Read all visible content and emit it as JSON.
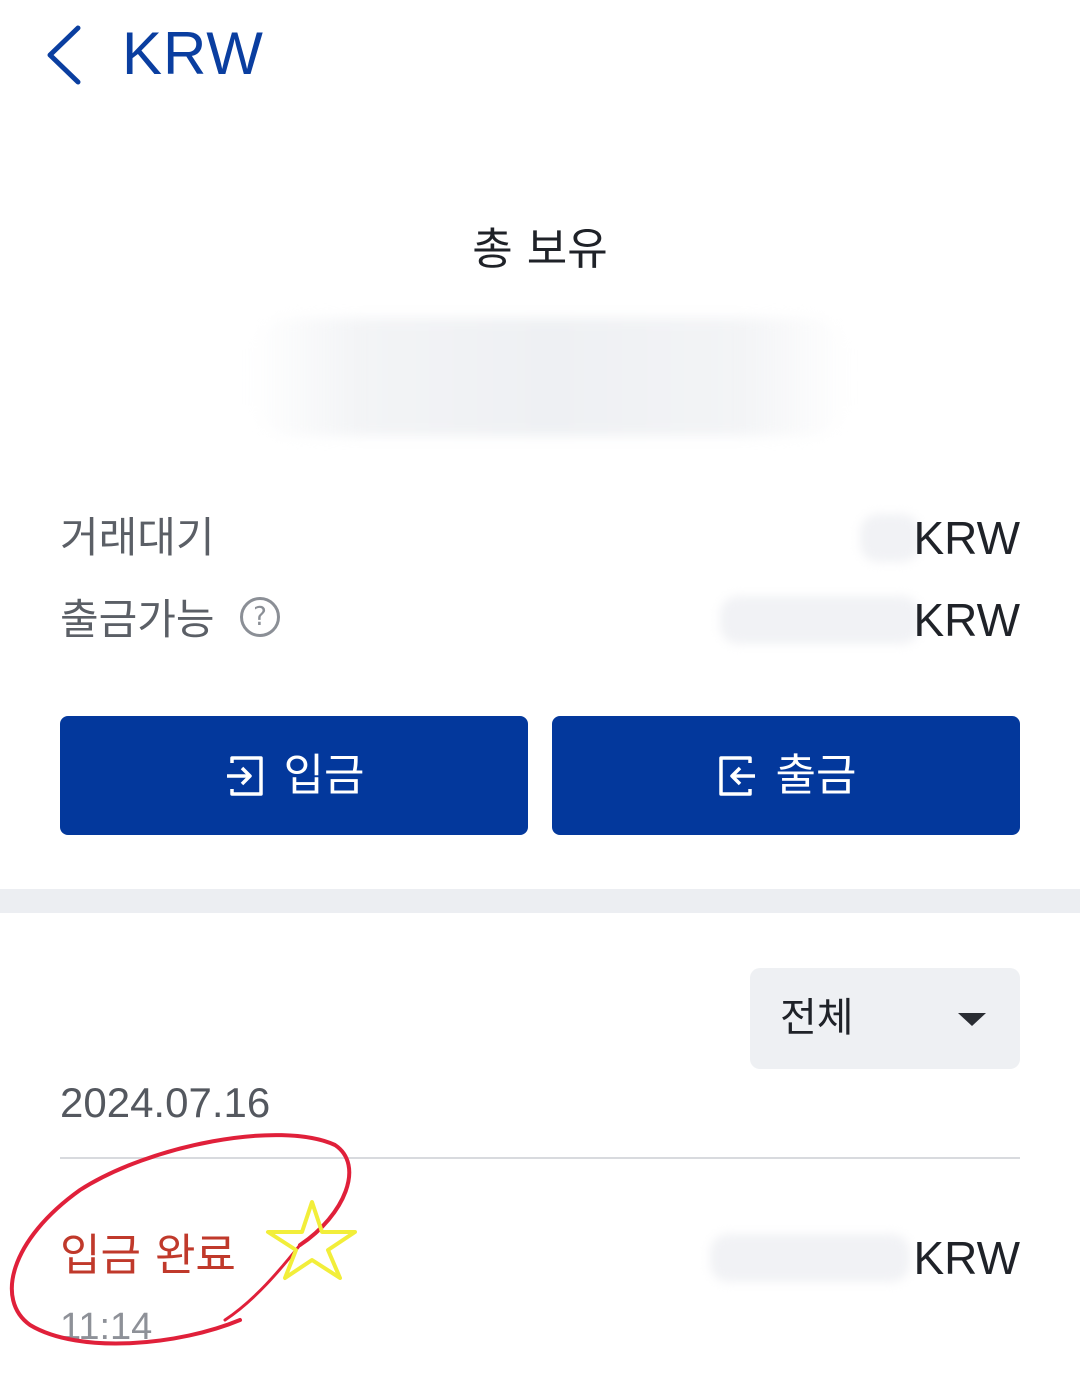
{
  "header": {
    "title": "KRW"
  },
  "summary": {
    "total_label": "총 보유"
  },
  "balances": [
    {
      "label": "거래대기",
      "unit": "KRW"
    },
    {
      "label": "출금가능",
      "unit": "KRW"
    }
  ],
  "actions": {
    "deposit_label": "입금",
    "withdraw_label": "출금",
    "primary_color": "#03389c"
  },
  "filter": {
    "selected": "전체"
  },
  "history": {
    "date": "2024.07.16",
    "items": [
      {
        "status": "입금 완료",
        "time": "11:14",
        "unit": "KRW",
        "status_color": "#c0392b"
      }
    ]
  },
  "icons": {
    "back": "chevron-left-icon",
    "help": "question-circle-icon",
    "deposit": "login-arrow-icon",
    "withdraw": "logout-arrow-icon",
    "dropdown": "caret-down-icon"
  }
}
